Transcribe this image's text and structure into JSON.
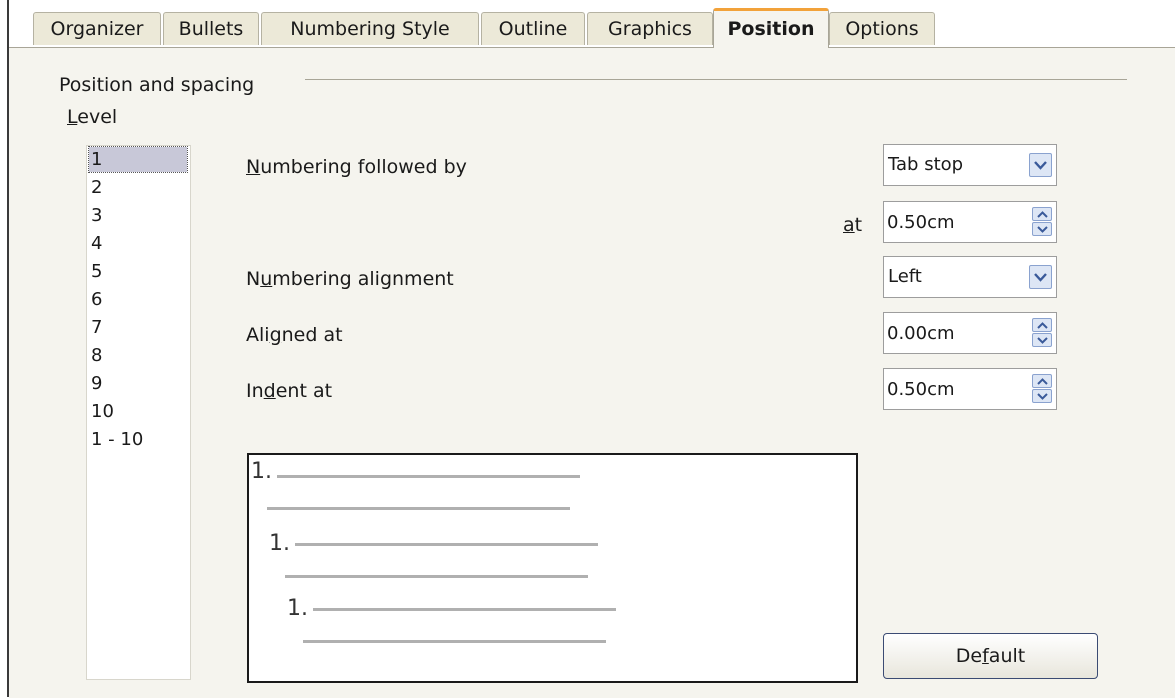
{
  "tabs": [
    {
      "label": "Organizer",
      "active": false
    },
    {
      "label": "Bullets",
      "active": false
    },
    {
      "label": "Numbering Style",
      "active": false
    },
    {
      "label": "Outline",
      "active": false
    },
    {
      "label": "Graphics",
      "active": false
    },
    {
      "label": "Position",
      "active": true
    },
    {
      "label": "Options",
      "active": false
    }
  ],
  "section": {
    "title": "Position and spacing"
  },
  "level": {
    "label_mnemonic": "L",
    "label_rest": "evel",
    "items": [
      "1",
      "2",
      "3",
      "4",
      "5",
      "6",
      "7",
      "8",
      "9",
      "10",
      "1 - 10"
    ],
    "selected": "1"
  },
  "fields": {
    "numbering_followed_by": {
      "mnemonic": "N",
      "rest": "umbering followed by",
      "value": "Tab stop"
    },
    "at": {
      "mnemonic": "a",
      "rest": "t",
      "value": "0.50cm"
    },
    "numbering_alignment": {
      "pre": "N",
      "mnemonic": "u",
      "rest": "mbering alignment",
      "value": "Left"
    },
    "aligned_at": {
      "pre": "Ali",
      "mnemonic": "g",
      "rest": "ned at",
      "value": "0.00cm"
    },
    "indent_at": {
      "pre": "In",
      "mnemonic": "d",
      "rest": "ent at",
      "value": "0.50cm"
    }
  },
  "preview": {
    "numbers": [
      "1.",
      "1.",
      "1."
    ]
  },
  "buttons": {
    "default": {
      "pre": "De",
      "mnemonic": "f",
      "rest": "ault"
    }
  },
  "icons": {
    "dropdown": "chevron-down-icon",
    "spin_up": "chevron-up-icon",
    "spin_down": "chevron-down-icon"
  },
  "colors": {
    "active_tab_accent": "#f2a23a",
    "panel_bg": "#f5f4ee",
    "tab_bg": "#ece9d8",
    "selection": "#c8c8d8"
  }
}
